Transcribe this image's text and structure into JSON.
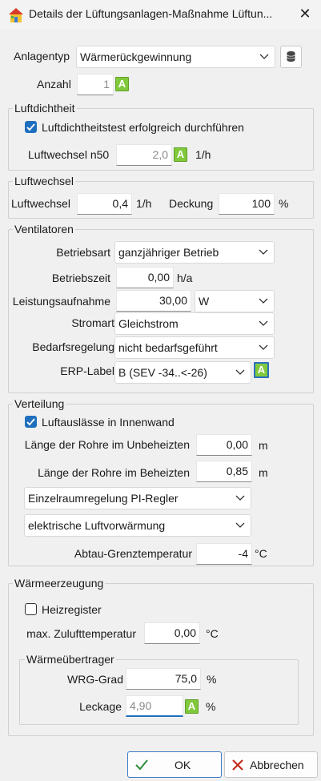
{
  "window": {
    "title": "Details der Lüftungsanlagen-Maßnahme Lüftun...",
    "app_icon": "house-icon",
    "close_icon": "close-icon"
  },
  "anlage": {
    "anlagentyp_label": "Anlagentyp",
    "anlagentyp_value": "Wärmerückgewinnung",
    "anzahl_label": "Anzahl",
    "anzahl_value": "1",
    "auto_badge": "A"
  },
  "luftdichtheit": {
    "title": "Luftdichtheit",
    "checkbox_label": "Luftdichtheitstest erfolgreich durchführen",
    "checked": true,
    "n50_label": "Luftwechsel n50",
    "n50_value": "2,0",
    "n50_unit": "1/h"
  },
  "luftwechsel": {
    "title": "Luftwechsel",
    "lw_label": "Luftwechsel",
    "lw_value": "0,4",
    "lw_unit": "1/h",
    "deckung_label": "Deckung",
    "deckung_value": "100",
    "deckung_unit": "%"
  },
  "ventilatoren": {
    "title": "Ventilatoren",
    "betriebsart_label": "Betriebsart",
    "betriebsart_value": "ganzjähriger Betrieb",
    "betriebszeit_label": "Betriebszeit",
    "betriebszeit_value": "0,00",
    "betriebszeit_unit": "h/a",
    "leistung_label": "Leistungsaufnahme",
    "leistung_value": "30,00",
    "leistung_unit": "W",
    "stromart_label": "Stromart",
    "stromart_value": "Gleichstrom",
    "bedarf_label": "Bedarfsregelung",
    "bedarf_value": "nicht bedarfsgeführt",
    "erp_label": "ERP-Label",
    "erp_value": "B (SEV -34..<-26)"
  },
  "verteilung": {
    "title": "Verteilung",
    "checkbox_label": "Luftauslässe in Innenwand",
    "checked": true,
    "unbeheizt_label": "Länge der Rohre im Unbeheizten",
    "unbeheizt_value": "0,00",
    "unbeheizt_unit": "m",
    "beheizt_label": "Länge der Rohre im Beheizten",
    "beheizt_value": "0,85",
    "beheizt_unit": "m",
    "regler_value": "Einzelraumregelung PI-Regler",
    "vorwaermung_value": "elektrische Luftvorwärmung",
    "abtau_label": "Abtau-Grenztemperatur",
    "abtau_value": "-4",
    "abtau_unit": "°C"
  },
  "waermeerzeugung": {
    "title": "Wärmeerzeugung",
    "heizregister_label": "Heizregister",
    "heizregister_checked": false,
    "zuluft_label": "max. Zulufttemperatur",
    "zuluft_value": "0,00",
    "zuluft_unit": "°C",
    "wue_title": "Wärmeübertrager",
    "wrg_label": "WRG-Grad",
    "wrg_value": "75,0",
    "wrg_unit": "%",
    "leckage_label": "Leckage",
    "leckage_value": "4,90",
    "leckage_unit": "%"
  },
  "buttons": {
    "ok": "OK",
    "cancel": "Abbrechen"
  },
  "colors": {
    "accent": "#1f6fbf",
    "auto_badge": "#80c93c",
    "ok_check": "#2e8b3a",
    "cancel_x": "#c42b1c"
  }
}
